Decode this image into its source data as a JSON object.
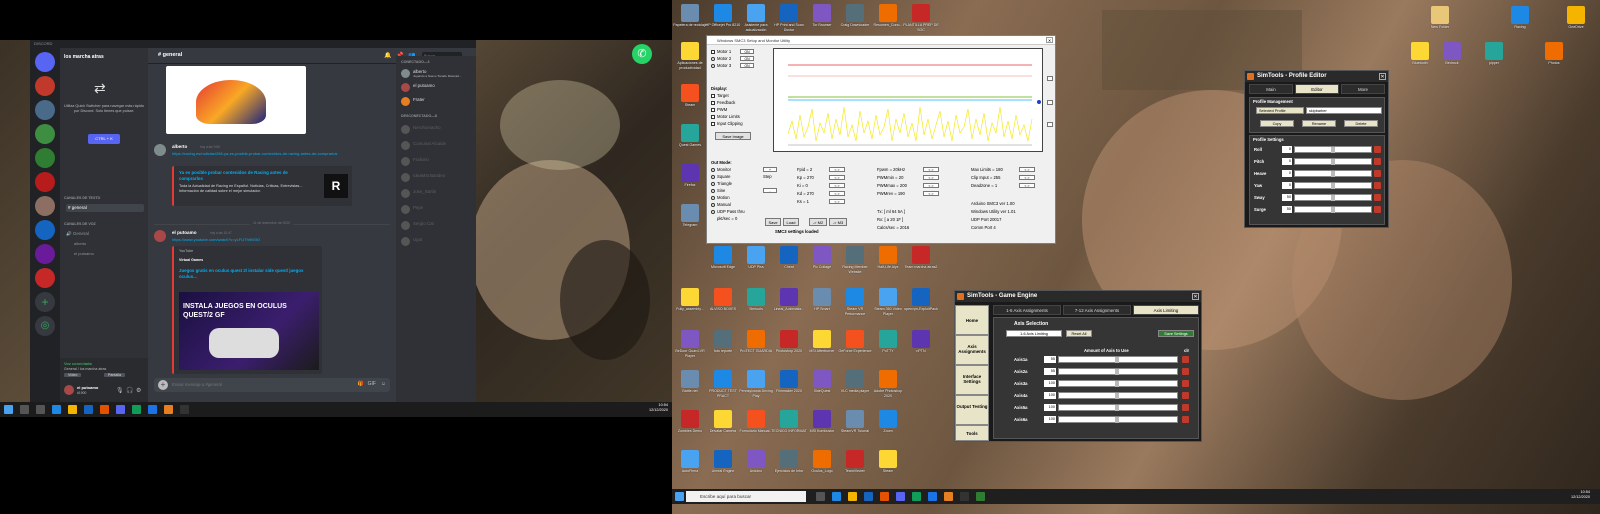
{
  "discord": {
    "app_label": "DISCORD",
    "server_name": "los marcha atras",
    "quickswitcher": {
      "text": "Utiliza Quick Switcher para navegar más rápido por Discord. Solo tienes que pulsar:",
      "button": "CTRL + K"
    },
    "categories": {
      "text": "CANALES DE TEXTO",
      "voice": "CANALES DE VOZ"
    },
    "text_channel": "general",
    "voice_channel": "General",
    "voice_users": [
      "alberto",
      "el putoamo"
    ],
    "voice_status": {
      "connected": "Voz conectada",
      "server": "General / los marcha atras",
      "video": "Vídeo",
      "screen": "Pantalla"
    },
    "user": {
      "name": "el putoamo",
      "tag": "#1900"
    },
    "header": {
      "channel": "general",
      "search": "Buscar"
    },
    "messages": [
      {
        "author": "alberto",
        "time": "hoy a las 9:56",
        "link": "https://racing.es/noticias/266-ya-es-posible-probar-contenidos-de-racing-antes-de-comprarlos",
        "embed_title": "Ya es posible probar contenidos de Racing antes de comprarlos",
        "embed_desc": "Toda la Actualidad de Racing en Español. Noticias, Criticas, Entrevistas... Información de calidad sobre el mejor simulador."
      },
      {
        "author": "el putoamo",
        "time": "hoy a las 10:47",
        "link": "https://www.youtube.com/watch?v=yLFUTh9W3O",
        "embed_site": "YouTube",
        "embed_channel": "Virtual Games",
        "embed_title": "Juegos gratis en oculus quest 2/ instalar side quest/ juegos oculus...",
        "thumb_text": "INSTALA JUEGOS EN OCULUS QUEST/2 GF"
      }
    ],
    "date_divider": "11 de diciembre de 2020",
    "input_placeholder": "Enviar mensaje a #general",
    "members": {
      "online_header": "CONECTADO—3",
      "online": [
        {
          "name": "alberto",
          "status": "Jugando a Nuevo Tocado Retocad..."
        },
        {
          "name": "el putoamo",
          "status": ""
        },
        {
          "name": "Frater",
          "status": ""
        }
      ],
      "offline_header": "DESCONECTADO—8",
      "offline": [
        "Nerohomacho",
        "Comunal Alcaide",
        "Frailurio",
        "IdeaMat Bandeo",
        "Jose_Sartin",
        "Pepe",
        "Sergio Cat",
        "Ugot"
      ]
    }
  },
  "taskbar1": {
    "time": "10:54",
    "date": "12/12/2020"
  },
  "taskbar2": {
    "search": "Escribe aquí para buscar",
    "time": "10:54",
    "date": "12/12/2020"
  },
  "smc3": {
    "title": "Windows SMC3 Setup and Monitor Utility",
    "motors": [
      "Motor 1",
      "Motor 2",
      "Motor 3"
    ],
    "motor_state": "ON",
    "display_header": "Display:",
    "display_opts": [
      "Target",
      "Feedback",
      "PWM",
      "Motor Limits",
      "Input Clipping"
    ],
    "save_image": "Save Image",
    "outmode_header": "Out Mode:",
    "outmodes": [
      "Monitor",
      "Square",
      "Triangle",
      "Sine",
      "Motion",
      "Manual",
      "UDP Pass thru",
      "pkt/sec = 0"
    ],
    "step": "Step",
    "params": [
      "Fpid = 2",
      "Kp = 270",
      "Ki = 0",
      "Kd = 270",
      "Ks = 1"
    ],
    "params2": [
      "Fpwm = 20kHz",
      "PWMmin = 20",
      "PWMmax = 200",
      "PWMrev = 190"
    ],
    "params3": [
      "Max Limits = 180",
      "Clip Input = 255",
      "Deadzone = 1"
    ],
    "info": [
      "Arduino SMC3 ver 1.00",
      "Windows Utility ver 1.01",
      "UDP Port 20017",
      "Comm Port 4"
    ],
    "txrc": [
      "Tx: [ ml 64 5A ]",
      "Rx: [ a 20 1F ]",
      "Calcs/sec = 2016"
    ],
    "buttons": [
      "Save",
      "Load",
      "-> M2",
      "-> M3"
    ],
    "status": "SMC3 settings loaded"
  },
  "profile_editor": {
    "title": "SimTools - Profile Editor",
    "tabs": [
      "Main",
      "Editor",
      "More"
    ],
    "management": "Profile Management",
    "selected_label": "Selected Profile",
    "selected_value": "skipbarber",
    "buttons": [
      "Copy",
      "Rename",
      "Delete"
    ],
    "settings": "Profile Settings",
    "rows": [
      {
        "name": "Roll",
        "val": "0"
      },
      {
        "name": "Pitch",
        "val": "0"
      },
      {
        "name": "Heave",
        "val": "0"
      },
      {
        "name": "Yaw",
        "val": "0"
      },
      {
        "name": "Sway",
        "val": "50"
      },
      {
        "name": "Surge",
        "val": "50"
      }
    ]
  },
  "game_engine": {
    "title": "SimTools - Game Engine",
    "side": [
      "Home",
      "Axis Assignments",
      "Interface Settings",
      "Output Testing",
      "Tools"
    ],
    "tabs": [
      "1-6 Axis Assignments",
      "7-12 Axis Assignments",
      "Axis Limiting"
    ],
    "axis_selection": "Axis Selection",
    "sel1": "1-6 Axis Limiting",
    "reset": "Reset All",
    "save": "Save Settings",
    "amount": "Amount of Axis to Use",
    "clr": "clr",
    "rows": [
      {
        "name": "Axis1a",
        "val": "55"
      },
      {
        "name": "Axis2a",
        "val": "55"
      },
      {
        "name": "Axis3a",
        "val": "100"
      },
      {
        "name": "Axis4a",
        "val": "100"
      },
      {
        "name": "Axis5a",
        "val": "100"
      },
      {
        "name": "Axis6a",
        "val": "100"
      }
    ]
  },
  "desktop_icons": [
    "Papelera de reciclaje",
    "HP Officejet Pro 8210",
    "Asistente para actualización",
    "HP Print and Scan Doctor",
    "Tor Browser",
    "Craig Downloader",
    "Resumen_Cono...",
    "PLANTILLA PREP DE SOC",
    "Aplicaciones de productividad",
    "Steam",
    "Quest Games",
    "Firefox",
    "Telegram",
    "Microsoft Edge",
    "UDP Piss",
    "Cheat",
    "Pic Collage",
    "Racing Member Website",
    "Half-Life Alyx",
    "Team marcha atras2",
    "Fully_assembly...",
    "ALVISO BOXES",
    "Simtools",
    "Lineal_Automatiz...",
    "HP Smart",
    "Steam VR Pertormance",
    "Steam 360 Video Player",
    "openvpn-ExploitPack",
    "BeDoor Guard-VR Player",
    "foto reporte",
    "ProTECT GUARDIA",
    "Photoshop 2020",
    "MSI Afterburner",
    "GeForce Experience",
    "PuTTY",
    "nPTN",
    "Battle.net",
    "PRODUCT TEST PRACT",
    "Pennsylvania Driving Play",
    "Filmmaker 2020",
    "SideQuest",
    "VLC media player",
    "Adobe Photoshop 2020",
    "Zombies Demo",
    "Drivatar Camera",
    "Formulario Manual...",
    "TECNICO INFORMAT",
    "MSI Kombustor",
    "SteamVR Tutorial",
    "Zoom",
    "AutoFirma",
    "Unreal Engine",
    "Arduino",
    "Ejercicios de Infor",
    "Oculus_Logo",
    "TeamViewer",
    "Steam",
    "Adobe Photo",
    "Call of Duty Modern Warfare",
    "Microsoft Maquette",
    "SOUCTUD CREADA"
  ],
  "right_icons": [
    "New Folder",
    "Racing",
    "OneDrive",
    "Carpeta",
    "Bluetooth",
    "Bedrock",
    "pipper",
    "Photos",
    "plantilla_dal",
    "carpeta",
    "logo_escuela",
    "Carpeta_nuev",
    "Ajustes",
    "Windows Tools",
    "Descargas",
    "Nuevo"
  ]
}
